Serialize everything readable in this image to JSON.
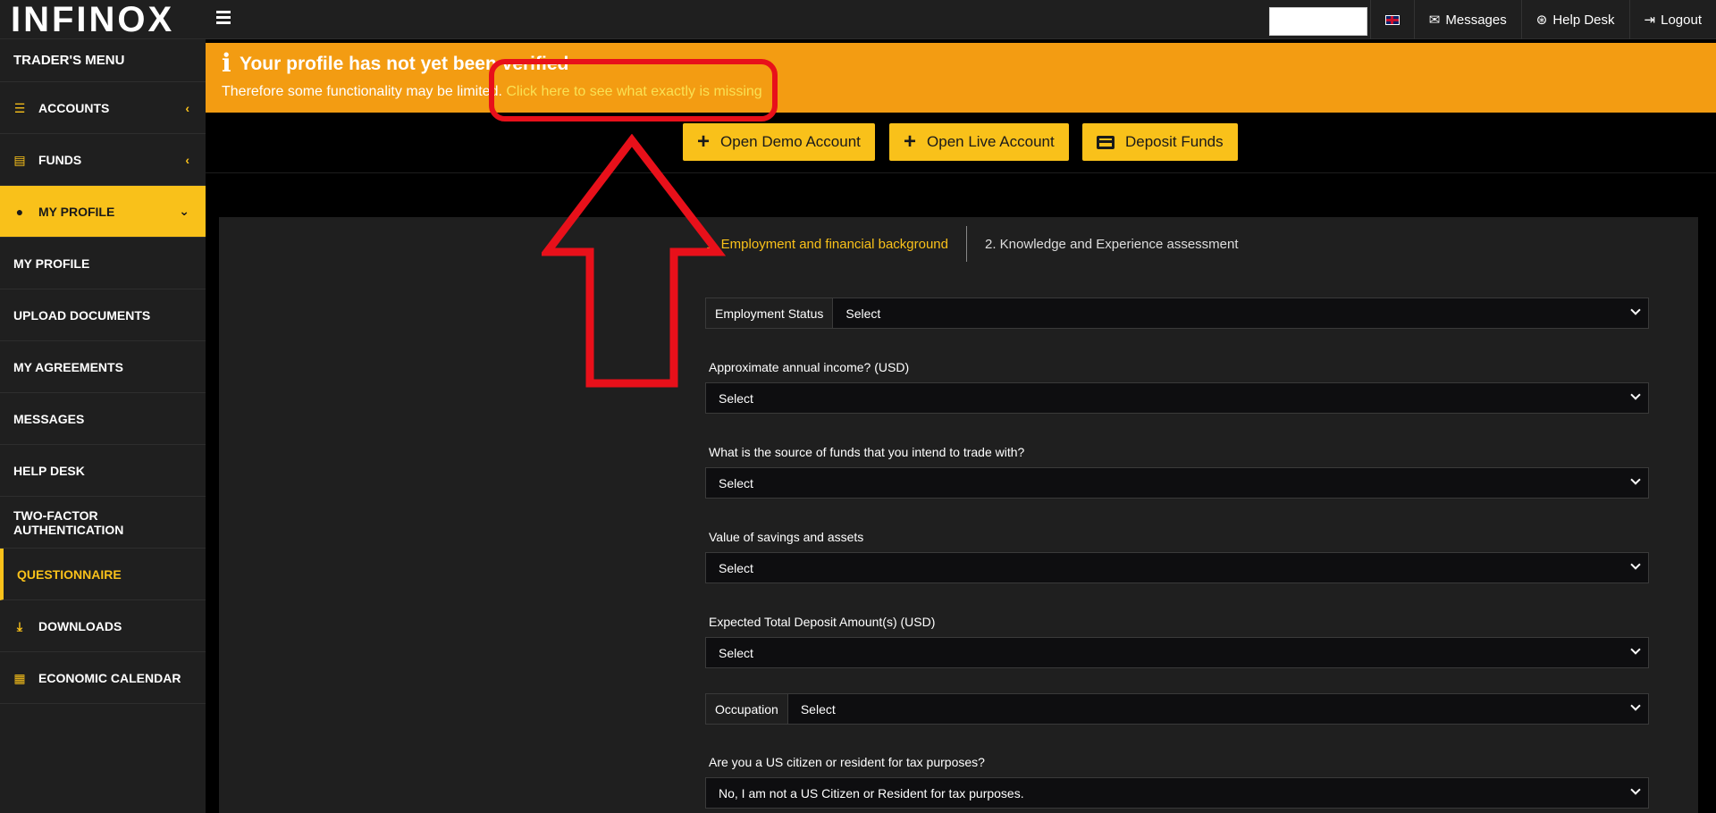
{
  "header": {
    "logo_text": "INFINOX",
    "nav": {
      "messages": "Messages",
      "help_desk": "Help Desk",
      "logout": "Logout"
    }
  },
  "sidebar": {
    "title": "TRADER'S MENU",
    "accounts": "ACCOUNTS",
    "funds": "FUNDS",
    "my_profile": "MY PROFILE",
    "sub": {
      "my_profile": "MY PROFILE",
      "upload_documents": "UPLOAD DOCUMENTS",
      "my_agreements": "MY AGREEMENTS",
      "messages": "MESSAGES",
      "help_desk": "HELP DESK",
      "two_factor": "TWO-FACTOR AUTHENTICATION",
      "questionnaire": "QUESTIONNAIRE"
    },
    "downloads": "DOWNLOADS",
    "economic_calendar": "ECONOMIC CALENDAR"
  },
  "banner": {
    "title": "Your profile has not yet been verified",
    "text": "Therefore some functionality may be limited.",
    "link": "Click here to see what exactly is missing"
  },
  "actions": {
    "open_demo": "Open Demo Account",
    "open_live": "Open Live Account",
    "deposit": "Deposit Funds"
  },
  "steps": {
    "step1": "1.  Employment and financial background",
    "step2": "2. Knowledge and Experience assessment"
  },
  "form": {
    "employment_status": {
      "label": "Employment Status",
      "value": "Select"
    },
    "annual_income": {
      "label": "Approximate annual income? (USD)",
      "value": "Select"
    },
    "source_of_funds": {
      "label": "What is the source of funds that you intend to trade with?",
      "value": "Select"
    },
    "savings": {
      "label": "Value of savings and assets",
      "value": "Select"
    },
    "deposit_amount": {
      "label": "Expected Total Deposit Amount(s) (USD)",
      "value": "Select"
    },
    "occupation": {
      "label": "Occupation",
      "value": "Select"
    },
    "us_citizen": {
      "label": "Are you a US citizen or resident for tax purposes?",
      "value": "No, I am not a US Citizen or Resident for tax purposes."
    }
  },
  "colors": {
    "accent": "#f9c11a",
    "banner": "#f39c12",
    "annotation": "#e8101a"
  }
}
